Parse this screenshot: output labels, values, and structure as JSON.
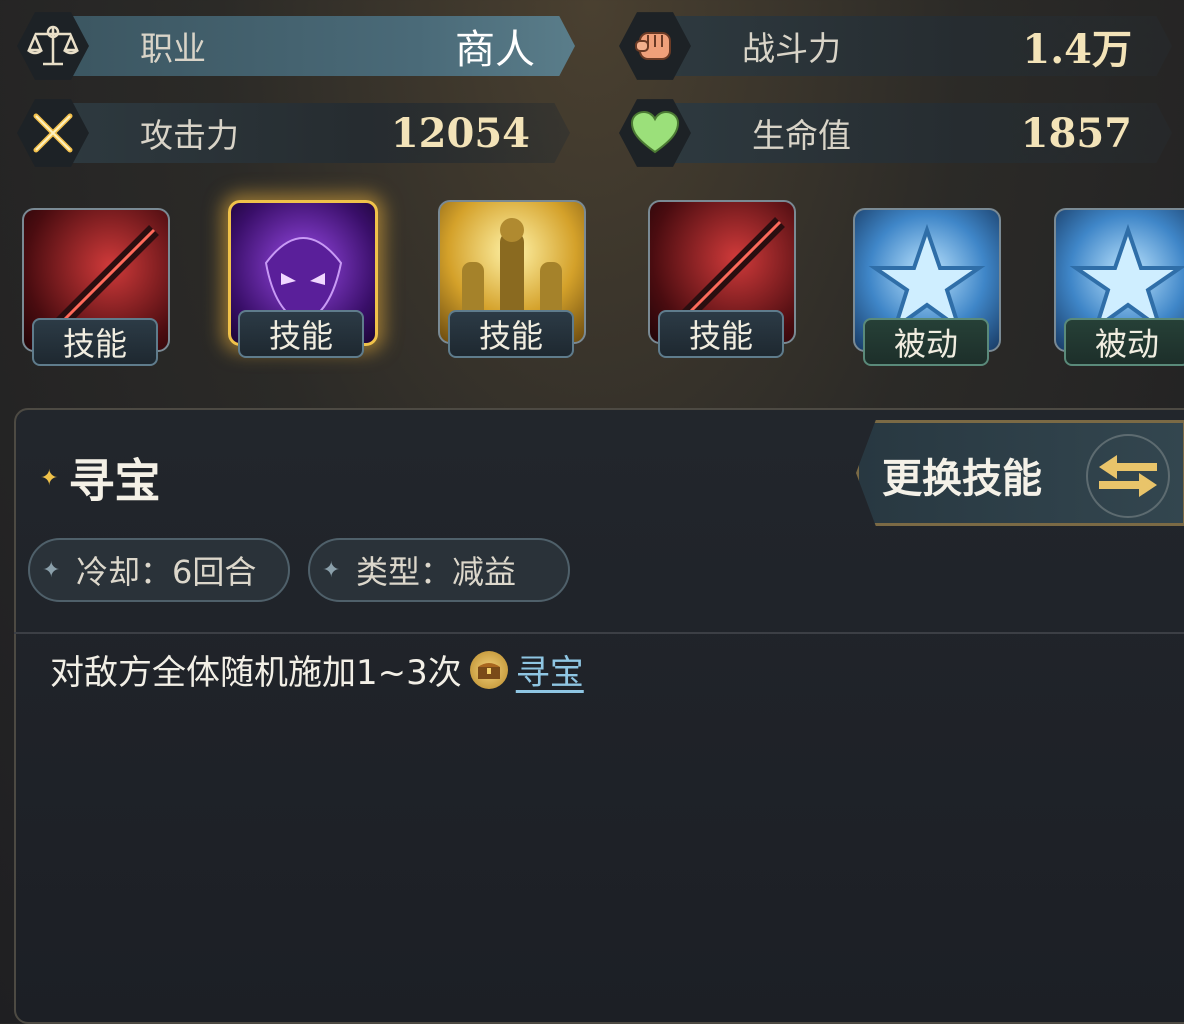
{
  "stats": {
    "job": {
      "label": "职业",
      "value": "商人"
    },
    "power": {
      "label": "战斗力",
      "value": "1.4万"
    },
    "attack": {
      "label": "攻击力",
      "value": "12054"
    },
    "hp": {
      "label": "生命值",
      "value": "1857"
    }
  },
  "skills": [
    {
      "tag": "技能",
      "art": "red-blade-icon"
    },
    {
      "tag": "技能",
      "art": "purple-demon-icon",
      "selected": true
    },
    {
      "tag": "技能",
      "art": "golden-knights-icon"
    },
    {
      "tag": "技能",
      "art": "red-blade-icon"
    },
    {
      "tag": "被动",
      "art": "blue-star-icon"
    },
    {
      "tag": "被动",
      "art": "blue-star-icon"
    }
  ],
  "detail": {
    "name": "寻宝",
    "cooldown": "冷却：6回合",
    "type": "类型：减益",
    "desc_prefix": "对敌方全体随机施加1~3次",
    "desc_link": "寻宝",
    "swap_label": "更换技能"
  },
  "colors": {
    "accent_gold": "#f0c24a",
    "link": "#8fc6e3"
  }
}
